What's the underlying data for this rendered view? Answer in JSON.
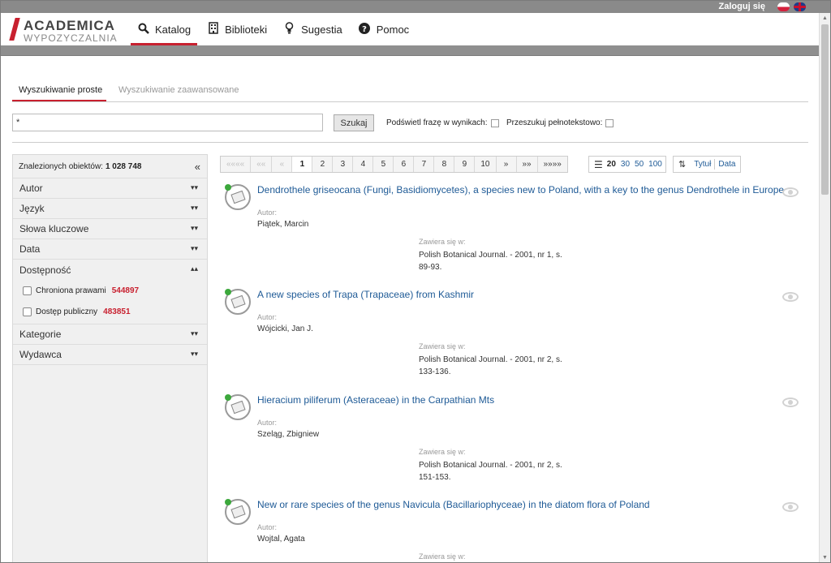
{
  "topbar": {
    "login_label": "Zaloguj się",
    "lang_pl": "PL",
    "lang_en": "EN"
  },
  "logo": {
    "line1": "ACADEMICA",
    "line2": "WYPOZYCZALNIA"
  },
  "nav": [
    {
      "label": "Katalog",
      "icon": "search-icon",
      "active": true
    },
    {
      "label": "Biblioteki",
      "icon": "building-icon",
      "active": false
    },
    {
      "label": "Sugestia",
      "icon": "lightbulb-icon",
      "active": false
    },
    {
      "label": "Pomoc",
      "icon": "help-icon",
      "active": false
    }
  ],
  "tabs": {
    "simple": "Wyszukiwanie proste",
    "advanced": "Wyszukiwanie zaawansowane"
  },
  "search": {
    "value": "*",
    "button": "Szukaj",
    "highlight_label": "Podświetl frazę w wynikach:",
    "fulltext_label": "Przeszukuj pełnotekstowo:"
  },
  "sidebar": {
    "found_label": "Znalezionych obiektów:",
    "found_count": "1 028 748",
    "facets": {
      "autor": "Autor",
      "jezyk": "Język",
      "slowa": "Słowa kluczowe",
      "data": "Data",
      "dostepnosc": "Dostępność",
      "kategorie": "Kategorie",
      "wydawca": "Wydawca"
    },
    "dostepnosc_options": [
      {
        "label": "Chroniona prawami",
        "count": "544897"
      },
      {
        "label": "Dostęp publiczny",
        "count": "483851"
      }
    ]
  },
  "pager": {
    "first": "««««",
    "prev2": "««",
    "prev": "«",
    "pages": [
      "1",
      "2",
      "3",
      "4",
      "5",
      "6",
      "7",
      "8",
      "9",
      "10"
    ],
    "next": "»",
    "next2": "»»",
    "last": "»»»»",
    "current": "1"
  },
  "perpage": {
    "options": [
      "20",
      "30",
      "50",
      "100"
    ],
    "current": "20"
  },
  "sort": {
    "title": "Tytuł",
    "date": "Data"
  },
  "labels": {
    "author": "Autor:",
    "contains": "Zawiera się w:"
  },
  "results": [
    {
      "title": "Dendrothele griseocana (Fungi, Basidiomycetes), a species new to Poland, with a key to the genus Dendrothele in Europe",
      "author": "Piątek, Marcin",
      "source1": "Polish Botanical Journal. - 2001, nr 1, s.",
      "source2": "89-93."
    },
    {
      "title": "A new species of Trapa (Trapaceae) from Kashmir",
      "author": "Wójcicki, Jan J.",
      "source1": "Polish Botanical Journal. - 2001, nr 2, s.",
      "source2": "133-136."
    },
    {
      "title": "Hieracium piliferum (Asteraceae) in the Carpathian Mts",
      "author": "Szeląg, Zbigniew",
      "source1": "Polish Botanical Journal. - 2001, nr 2, s.",
      "source2": "151-153."
    },
    {
      "title": "New or rare species of the genus Navicula (Bacillariophyceae) in the diatom flora of Poland",
      "author": "Wojtal, Agata",
      "source1": "",
      "source2": ""
    }
  ],
  "colors": {
    "accent": "#c8202f",
    "link": "#1e5a96",
    "available": "#3ca83c"
  }
}
